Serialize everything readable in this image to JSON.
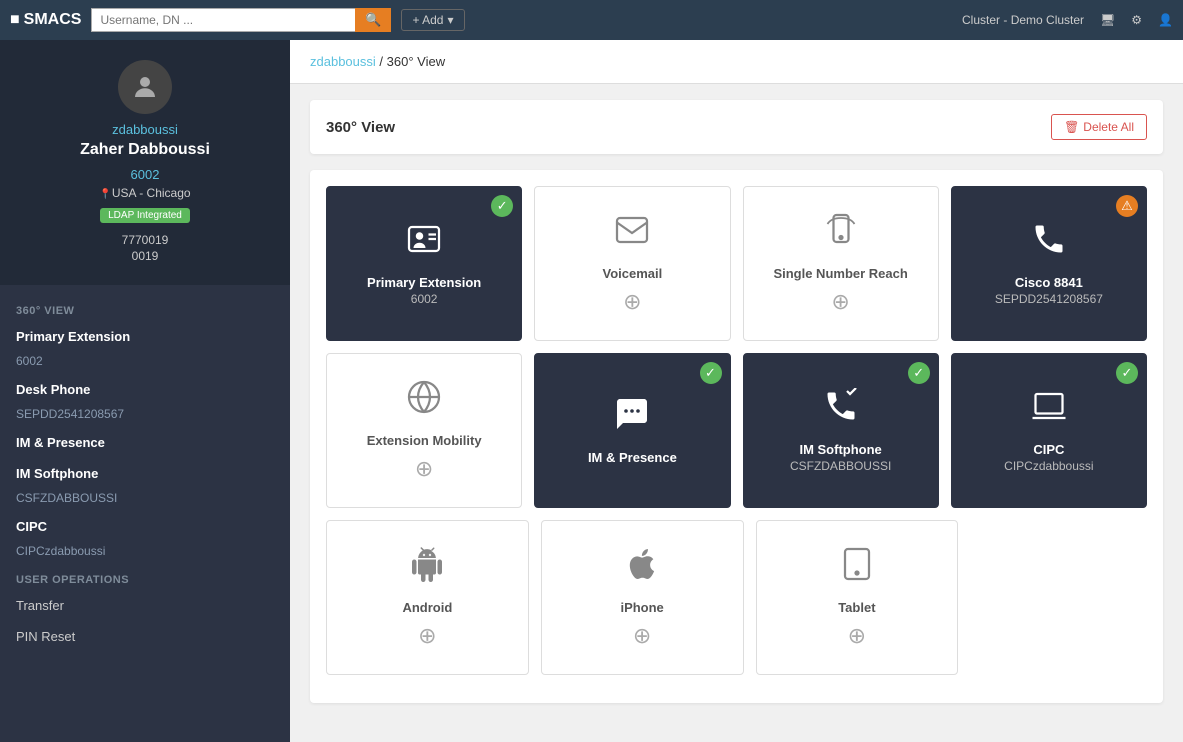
{
  "topbar": {
    "logo": "SMACS",
    "search_placeholder": "Username, DN ...",
    "add_label": "+ Add",
    "cluster_label": "Cluster - Demo Cluster",
    "search_icon": "🔍"
  },
  "sidebar": {
    "username": "zdabboussi",
    "fullname": "Zaher Dabboussi",
    "extension": "6002",
    "location": "USA - Chicago",
    "badge": "LDAP Integrated",
    "number1": "7770019",
    "number2": "0019",
    "section_title": "360° VIEW",
    "nav_items": [
      {
        "label": "Primary Extension",
        "sub": "6002"
      },
      {
        "label": "Desk Phone",
        "sub": "SEPDD2541208567"
      },
      {
        "label": "IM & Presence",
        "sub": ""
      },
      {
        "label": "IM Softphone",
        "sub": "CSFZDABBOUSSI"
      },
      {
        "label": "CIPC",
        "sub": "CIPCzdabboussi"
      }
    ],
    "user_ops_title": "USER OPERATIONS",
    "user_ops": [
      {
        "label": "Transfer"
      },
      {
        "label": "PIN Reset"
      }
    ]
  },
  "breadcrumb": {
    "link_label": "zdabboussi",
    "separator": "/",
    "current": "360° View"
  },
  "view_title": "360° View",
  "delete_all_label": "Delete All",
  "cards": [
    [
      {
        "id": "primary-extension",
        "label": "Primary Extension",
        "sublabel": "6002",
        "icon": "person-card",
        "dark": true,
        "status": "green",
        "add": false
      },
      {
        "id": "voicemail",
        "label": "Voicemail",
        "sublabel": "",
        "icon": "envelope",
        "dark": false,
        "status": null,
        "add": true
      },
      {
        "id": "single-number-reach",
        "label": "Single Number Reach",
        "sublabel": "",
        "icon": "mobile-ring",
        "dark": false,
        "status": null,
        "add": true
      },
      {
        "id": "cisco-8841",
        "label": "Cisco 8841",
        "sublabel": "SEPDD2541208567",
        "icon": "phone",
        "dark": true,
        "status": "orange",
        "add": false
      }
    ],
    [
      {
        "id": "extension-mobility",
        "label": "Extension Mobility",
        "sublabel": "",
        "icon": "globe",
        "dark": false,
        "status": null,
        "add": true
      },
      {
        "id": "im-presence",
        "label": "IM & Presence",
        "sublabel": "",
        "icon": "chat",
        "dark": true,
        "status": "green",
        "add": false
      },
      {
        "id": "im-softphone",
        "label": "IM Softphone",
        "sublabel": "CSFZDABBOUSSI",
        "icon": "phone-check",
        "dark": true,
        "status": "green",
        "add": false
      },
      {
        "id": "cipc",
        "label": "CIPC",
        "sublabel": "CIPCzdabboussi",
        "icon": "laptop",
        "dark": true,
        "status": "green",
        "add": false
      }
    ],
    [
      {
        "id": "android",
        "label": "Android",
        "sublabel": "",
        "icon": "android",
        "dark": false,
        "status": null,
        "add": true
      },
      {
        "id": "iphone",
        "label": "iPhone",
        "sublabel": "",
        "icon": "apple",
        "dark": false,
        "status": null,
        "add": true
      },
      {
        "id": "tablet",
        "label": "Tablet",
        "sublabel": "",
        "icon": "tablet",
        "dark": false,
        "status": null,
        "add": true
      },
      null
    ]
  ]
}
